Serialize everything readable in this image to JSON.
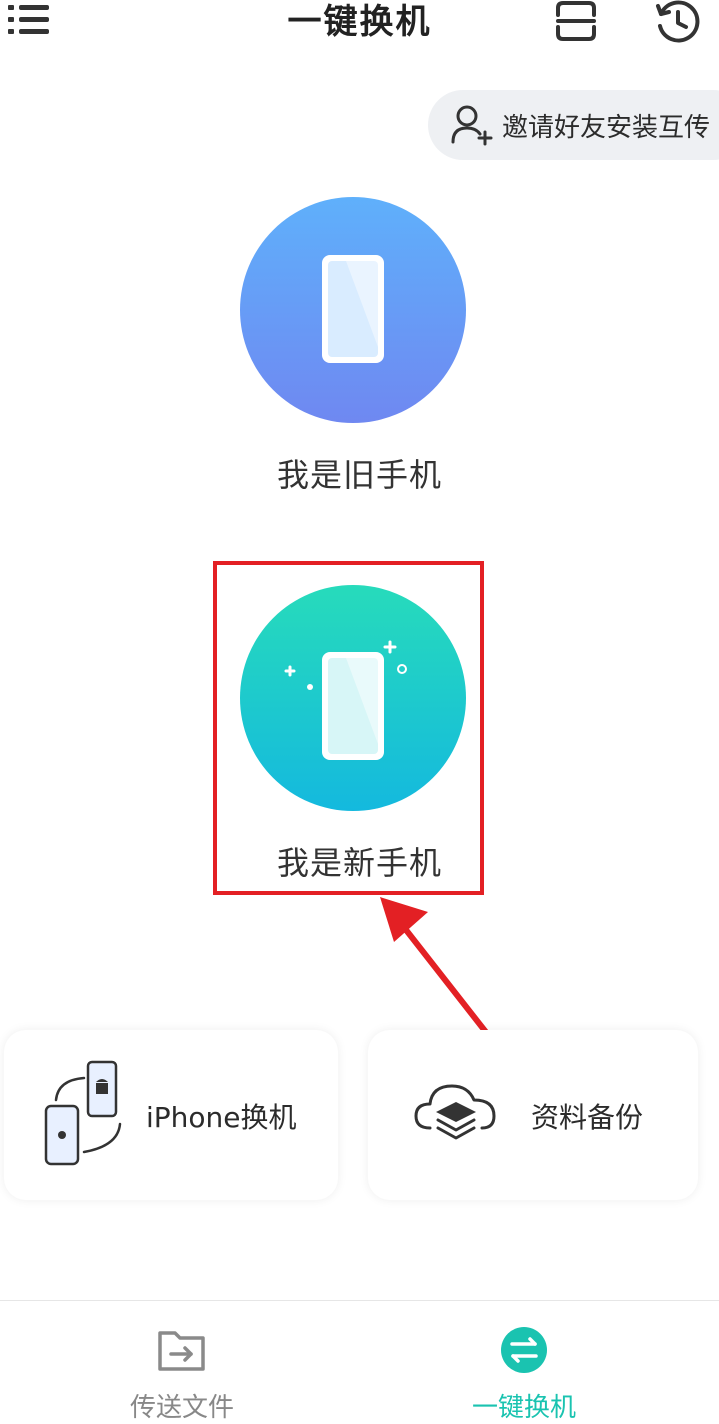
{
  "header": {
    "title": "一键换机",
    "menu_icon": "list-menu-icon",
    "scan_icon": "scan-icon",
    "history_icon": "history-clock-icon"
  },
  "invite": {
    "label": "邀请好友安装互传",
    "icon": "add-user-icon"
  },
  "roles": {
    "old_phone": {
      "label": "我是旧手机",
      "icon": "phone-icon"
    },
    "new_phone": {
      "label": "我是新手机",
      "icon": "phone-sparkle-icon"
    }
  },
  "features": [
    {
      "label": "iPhone换机",
      "icon": "iphone-android-transfer-icon"
    },
    {
      "label": "资料备份",
      "icon": "cloud-layers-icon"
    }
  ],
  "bottom_nav": [
    {
      "label": "传送文件",
      "icon": "folder-transfer-icon",
      "active": false
    },
    {
      "label": "一键换机",
      "icon": "swap-arrows-icon",
      "active": true
    }
  ],
  "colors": {
    "accent": "#1ac3b0",
    "old_phone_gradient_top": "#5fb0fb",
    "old_phone_gradient_bottom": "#6f88f1",
    "new_phone_gradient_top": "#27dbbb",
    "new_phone_gradient_bottom": "#14b9de",
    "annotation_red": "#e32024"
  }
}
